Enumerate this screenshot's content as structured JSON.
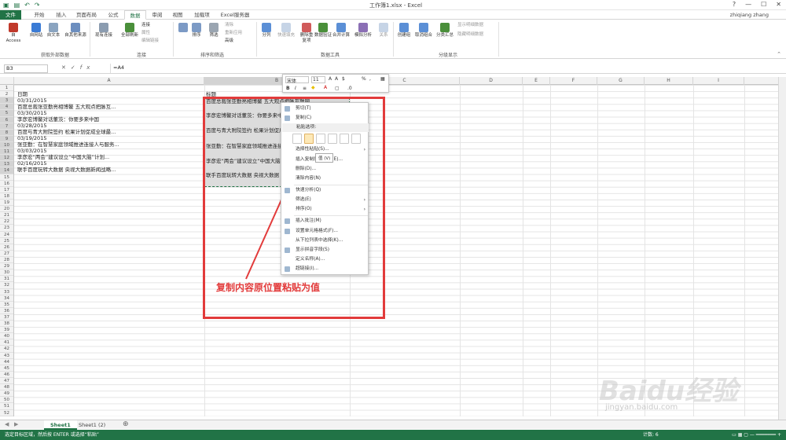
{
  "window": {
    "title": "工作簿1.xlsx - Excel",
    "user": "zhiqiang zhang",
    "help": "?"
  },
  "tabs": [
    {
      "label": "文件"
    },
    {
      "label": "开始"
    },
    {
      "label": "插入"
    },
    {
      "label": "页面布局"
    },
    {
      "label": "公式"
    },
    {
      "label": "数据"
    },
    {
      "label": "审阅"
    },
    {
      "label": "视图"
    },
    {
      "label": "加载项"
    },
    {
      "label": "Excel服务器"
    }
  ],
  "ribbon": {
    "groups": [
      {
        "label": "获取外部数据"
      },
      {
        "label": "连接"
      },
      {
        "label": "排序和筛选"
      },
      {
        "label": "数据工具"
      },
      {
        "label": "分级显示"
      }
    ],
    "buttons": {
      "access": "自 Access",
      "web": "自网站",
      "text": "自文本",
      "other": "自其他来源",
      "existing": "现有连接",
      "refresh": "全部刷新",
      "connections": "连接",
      "properties": "属性",
      "editlinks": "编辑链接",
      "sort": "排序",
      "filter": "筛选",
      "clear": "清除",
      "reapply": "重新应用",
      "advanced": "高级",
      "split": "分列",
      "flashfill": "快速填充",
      "removedup": "删除重复项",
      "validation": "数据验证",
      "consolidate": "合并计算",
      "whatif": "模拟分析",
      "relations": "关系",
      "group": "创建组",
      "ungroup": "取消组合",
      "subtotal": "分类汇总",
      "showdetail": "显示明细数据",
      "hidedetail": "隐藏明细数据"
    }
  },
  "formula_bar": {
    "name_box": "B3",
    "formula": "=A4"
  },
  "columns": [
    "A",
    "B",
    "C",
    "D",
    "E",
    "F",
    "G",
    "H",
    "I"
  ],
  "rows": [
    "1",
    "2",
    "3",
    "4",
    "5",
    "6",
    "7",
    "8",
    "9",
    "10",
    "11",
    "12",
    "13",
    "14",
    "15",
    "16",
    "17",
    "18",
    "19",
    "20",
    "21",
    "22",
    "23",
    "24",
    "25",
    "26",
    "27",
    "28",
    "29",
    "30",
    "31",
    "32",
    "33",
    "34",
    "35",
    "36",
    "37",
    "38",
    "39",
    "40",
    "41",
    "42",
    "43",
    "44",
    "45",
    "46",
    "47",
    "48",
    "49",
    "50",
    "51",
    "52"
  ],
  "col_a": [
    "日期",
    "03/31/2015",
    "百度总裁张亚勤亮相博鳌 五大观点把脉互...",
    "03/30/2015",
    "李彦宏博鳌对话董茨：你要多来中国",
    "03/28/2015",
    "百度与青大附院签约 松果计划促成全球最...",
    "03/19/2015",
    "张亚勤：在智慧家庭领域推进连接人与服务...",
    "03/03/2015",
    "李彦宏“两会”建议设立“中国大脑”计划...",
    "02/16/2015",
    "联手百度玩转大数据 央视大数据新闻战略..."
  ],
  "col_b": [
    "标题",
    "百度总裁张亚勤亮相博鳌 五大观点把脉互联网",
    "李彦宏博鳌对话董茨：你要多来中国",
    "百度与青大附院签约 松果计划促成全球",
    "张亚勤：在智慧家庭领域推进连接",
    "李彦宏“两会”建议设立“中国大脑”",
    "联手百度玩转大数据 央视大数据"
  ],
  "mini_toolbar": {
    "font": "宋体",
    "size": "11",
    "percent": "%",
    "bold": "B",
    "italic": "I"
  },
  "context_menu": {
    "cut": "剪切(T)",
    "copy": "复制(C)",
    "paste_options": "粘贴选项:",
    "paste_special": "选择性粘贴(S)...",
    "insert_copied": "插入复制的单元格(E)...",
    "delete": "删除(D)...",
    "clear": "清除内容(N)",
    "quick_analysis": "快速分析(Q)",
    "filter": "筛选(E)",
    "sort": "排序(O)",
    "insert_comment": "插入批注(M)",
    "format_cells": "设置单元格格式(F)...",
    "dropdown": "从下拉列表中选择(K)...",
    "phonetic": "显示拼音字段(S)",
    "define_name": "定义名称(A)...",
    "hyperlink": "超链接(I)...",
    "tooltip": "值 (V)"
  },
  "annotation": "复制内容原位置粘贴为值",
  "sheets": [
    {
      "label": "Sheet1"
    },
    {
      "label": "Sheet1 (2)"
    }
  ],
  "status": {
    "message": "选定目标区域，然后按 ENTER 或选择“粘贴”",
    "count": "计数: 6"
  },
  "watermark": {
    "text": "Baidu经验",
    "url": "jingyan.baidu.com"
  },
  "colors": {
    "accent": "#217346",
    "annotation": "#e23b3b"
  }
}
